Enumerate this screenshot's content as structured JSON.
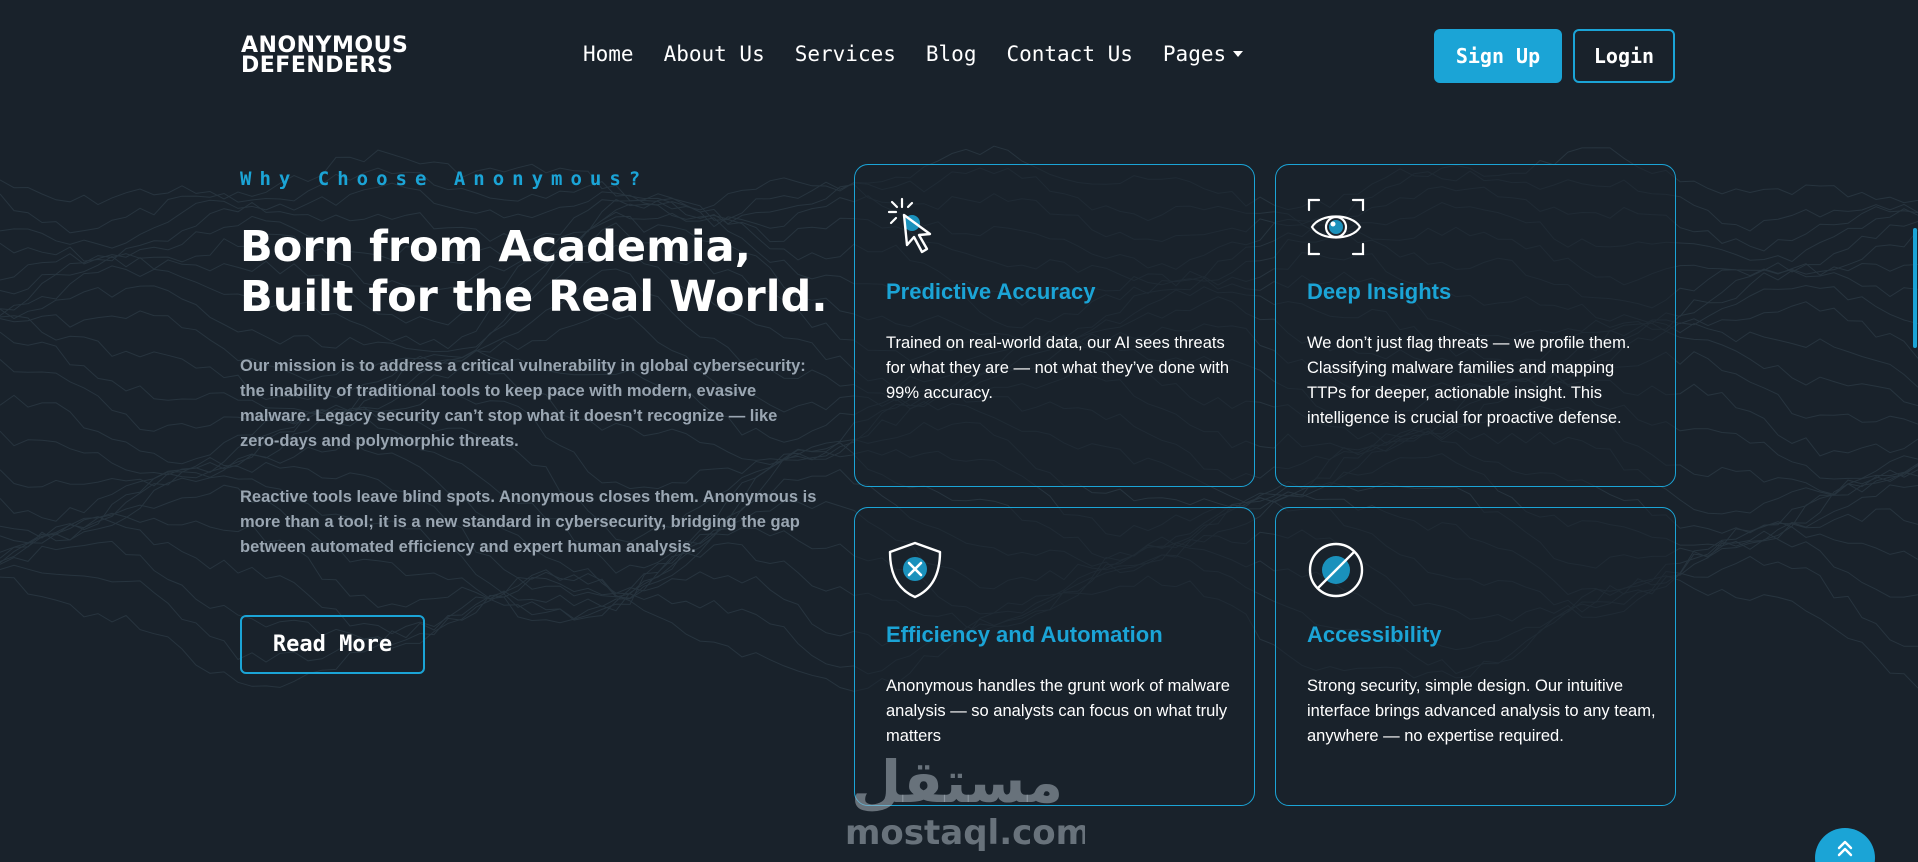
{
  "brand": {
    "line1": "ANONYMOUS",
    "line2": "DEFENDERS"
  },
  "nav": {
    "items": [
      "Home",
      "About Us",
      "Services",
      "Blog",
      "Contact Us",
      "Pages"
    ],
    "signup_label": "Sign Up",
    "login_label": "Login"
  },
  "hero": {
    "eyebrow": "Why Choose Anonymous?",
    "headline": "Born from Academia, Built for the Real World.",
    "para1": "Our mission is to address a critical vulnerability in global cybersecurity: the inability of traditional tools to keep pace with modern, evasive malware. Legacy security can’t stop what it doesn’t recognize — like zero-days and polymorphic threats.",
    "para2": "Reactive tools leave blind spots. Anonymous closes them. Anonymous is more than a tool; it is a new standard in cybersecurity, bridging the gap between automated efficiency and expert human analysis.",
    "read_more_label": "Read More"
  },
  "features": [
    {
      "icon": "cursor-click-icon",
      "title": "Predictive Accuracy",
      "desc": "Trained on real-world data, our AI sees threats for what they are — not what they’ve done with 99% accuracy."
    },
    {
      "icon": "eye-scan-icon",
      "title": "Deep Insights",
      "desc": "We don’t just flag threats — we profile them. Classifying malware families and mapping TTPs for deeper, actionable insight. This intelligence is crucial for proactive defense."
    },
    {
      "icon": "shield-x-icon",
      "title": "Efficiency and Automation",
      "desc": "Anonymous handles the grunt work of malware analysis — so analysts can focus on what truly matters"
    },
    {
      "icon": "no-entry-icon",
      "title": "Accessibility",
      "desc": "Strong security, simple design. Our intuitive interface brings advanced analysis to any team, anywhere — no expertise required."
    }
  ],
  "watermark": {
    "arabic": "مستقل",
    "latin": "mostaql.com"
  },
  "colors": {
    "background": "#19222b",
    "accent": "#1ba4d6",
    "muted_text": "#9aa6b2"
  }
}
